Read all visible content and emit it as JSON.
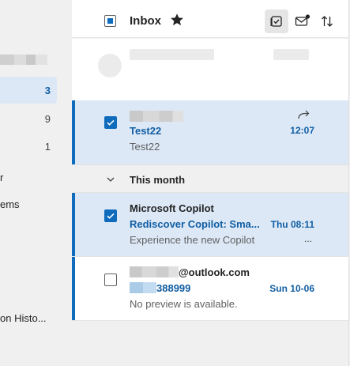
{
  "nav": {
    "items": [
      {
        "label": "",
        "count": "3"
      },
      {
        "label": "",
        "count": "9"
      },
      {
        "label": "",
        "count": "1"
      }
    ],
    "label_fragments": [
      "r",
      "ems",
      "on Histo..."
    ]
  },
  "header": {
    "title": "Inbox"
  },
  "messages": [
    {
      "sender": "",
      "subject": "Test22",
      "preview": "Test22",
      "time": "12:07",
      "selected": true,
      "forwarded": true
    },
    {
      "sender": "Microsoft Copilot",
      "subject": "Rediscover Copilot: Sma...",
      "preview": "Experience the new Copilot",
      "time": "Thu 08:11",
      "more": "...",
      "selected": true
    },
    {
      "sender": "@outlook.com",
      "subject": "388999",
      "preview": "No preview is available.",
      "time": "Sun 10-06",
      "selected": false
    }
  ],
  "groups": [
    {
      "label": "This month"
    }
  ],
  "colors": {
    "accent": "#0f6cbd",
    "selected_bg": "#dce8f6",
    "link_text": "#115ea3"
  }
}
